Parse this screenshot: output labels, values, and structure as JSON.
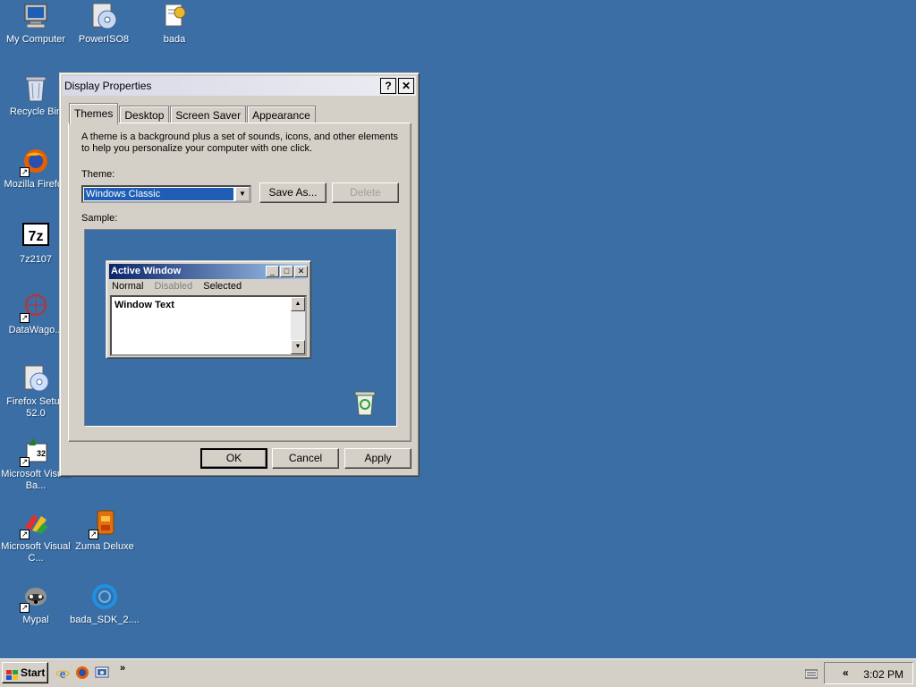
{
  "desktop": {
    "icons": [
      {
        "label": "My Computer",
        "icon": "my-computer-icon"
      },
      {
        "label": "PowerISO8",
        "icon": "poweriso-icon"
      },
      {
        "label": "bada",
        "icon": "folder-document-icon"
      },
      {
        "label": "Recycle Bin",
        "icon": "recycle-bin-icon"
      },
      {
        "label": "Mozilla Firefox",
        "icon": "firefox-icon"
      },
      {
        "label": "7z2107",
        "icon": "7zip-icon"
      },
      {
        "label": "DataWago...",
        "icon": "datawago-icon"
      },
      {
        "label": "Firefox Setup 52.0",
        "icon": "installer-icon"
      },
      {
        "label": "Microsoft Visual Ba...",
        "icon": "visual-basic-icon"
      },
      {
        "label": "bada_SDK_2...",
        "icon": "hidden-label"
      },
      {
        "label": "Microsoft Visual C...",
        "icon": "visual-c-icon"
      },
      {
        "label": "Zuma Deluxe",
        "icon": "zuma-icon"
      },
      {
        "label": "Mypal",
        "icon": "mypal-icon"
      },
      {
        "label": "bada_SDK_2....",
        "icon": "bada-sdk-icon"
      }
    ]
  },
  "dialog": {
    "title": "Display Properties",
    "help_btn": "?",
    "close_btn": "✕",
    "tabs": [
      "Themes",
      "Desktop",
      "Screen Saver",
      "Appearance"
    ],
    "active_tab": "Themes",
    "description": "A theme is a background plus a set of sounds, icons, and other elements to help you personalize your computer with one click.",
    "theme_label": "Theme:",
    "theme_value": "Windows Classic",
    "save_as": "Save As...",
    "delete": "Delete",
    "sample_label": "Sample:",
    "sample": {
      "title": "Active Window",
      "menu": [
        "Normal",
        "Disabled",
        "Selected"
      ],
      "text": "Window Text"
    },
    "ok": "OK",
    "cancel": "Cancel",
    "apply": "Apply"
  },
  "taskbar": {
    "start_label": "Start",
    "chevron": "»",
    "tray_chevron": "«",
    "clock": "3:02 PM"
  },
  "colors": {
    "desktop": "#3a6ea5",
    "face": "#d4d0c8",
    "active_caption": "#0a246a",
    "selection": "#1f5eb4"
  }
}
